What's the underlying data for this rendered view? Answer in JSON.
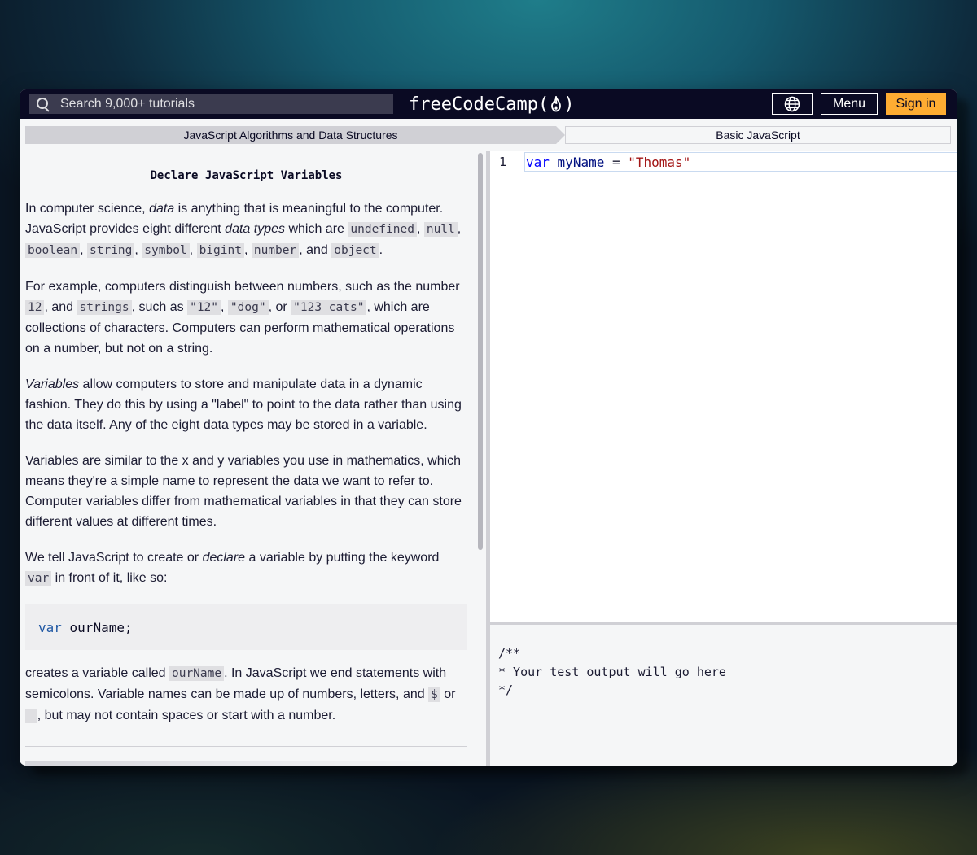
{
  "navbar": {
    "search_placeholder": "Search 9,000+ tutorials",
    "logo_prefix": "freeCodeCamp(",
    "logo_suffix": ")",
    "menu_label": "Menu",
    "signin_label": "Sign in"
  },
  "breadcrumb": {
    "superblock": "JavaScript Algorithms and Data Structures",
    "block": "Basic JavaScript"
  },
  "lesson": {
    "title": "Declare JavaScript Variables",
    "p1": {
      "t1": "In computer science, ",
      "e1": "data",
      "t2": " is anything that is meaningful to the computer. JavaScript provides eight different ",
      "e2": "data types",
      "t3": " which are ",
      "c1": "undefined",
      "c2": "null",
      "c3": "boolean",
      "c4": "string",
      "c5": "symbol",
      "c6": "bigint",
      "c7": "number",
      "t4": ", and ",
      "c8": "object",
      "t5": "."
    },
    "p2": {
      "t1": "For example, computers distinguish between numbers, such as the number ",
      "c1": "12",
      "t2": ", and ",
      "c2": "strings",
      "t3": ", such as ",
      "c3": "\"12\"",
      "c4": "\"dog\"",
      "t4": ", or ",
      "c5": "\"123 cats\"",
      "t5": ", which are collections of characters. Computers can perform mathematical operations on a number, but not on a string."
    },
    "p3": {
      "e1": "Variables",
      "t1": " allow computers to store and manipulate data in a dynamic fashion. They do this by using a \"label\" to point to the data rather than using the data itself. Any of the eight data types may be stored in a variable."
    },
    "p4": "Variables are similar to the x and y variables you use in mathematics, which means they're a simple name to represent the data we want to refer to. Computer variables differ from mathematical variables in that they can store different values at different times.",
    "p5": {
      "t1": "We tell JavaScript to create or ",
      "e1": "declare",
      "t2": " a variable by putting the keyword ",
      "c1": "var",
      "t3": " in front of it, like so:"
    },
    "example": {
      "keyword": "var",
      "rest": " ourName;"
    },
    "p6": {
      "t1": "creates a variable called ",
      "c1": "ourName",
      "t2": ". In JavaScript we end statements with semicolons. Variable names can be made up of numbers, letters, and ",
      "c2": "$",
      "t3": " or ",
      "c3": "_",
      "t4": ", but may not contain spaces or start with a number."
    }
  },
  "editor": {
    "line_number": "1",
    "keyword": "var",
    "identifier": "myName",
    "operator": " = ",
    "string": "\"Thomas\""
  },
  "output": {
    "text": "/**\n* Your test output will go here\n*/"
  },
  "colors": {
    "navbar_bg": "#0a0a23",
    "signin_bg": "#feac32",
    "keyword": "#0000ff",
    "string": "#a31515"
  }
}
